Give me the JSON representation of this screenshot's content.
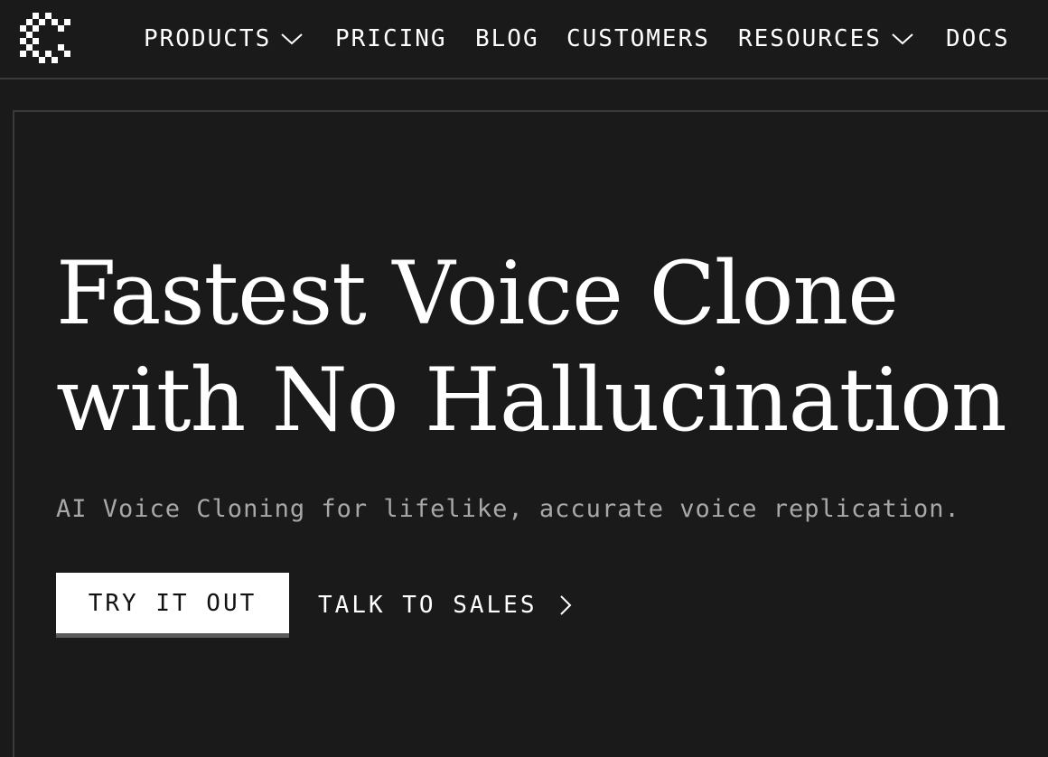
{
  "nav": {
    "products": "PRODUCTS",
    "pricing": "PRICING",
    "blog": "BLOG",
    "customers": "CUSTOMERS",
    "resources": "RESOURCES",
    "docs": "DOCS"
  },
  "icons": {
    "logo": "pixel-c-logo-icon",
    "dropdown": "chevron-down-icon",
    "arrow": "chevron-right-icon"
  },
  "hero": {
    "headline_line1": "Fastest Voice Clone",
    "headline_line2": "with No Hallucination",
    "subheadline": "AI Voice Cloning for lifelike, accurate voice replication.",
    "primary_cta": "TRY IT OUT",
    "secondary_cta": "TALK TO SALES"
  },
  "colors": {
    "background": "#1a1a1a",
    "text": "#ffffff",
    "muted_text": "#a8a8a8",
    "border": "#3a3a3a",
    "button_bg": "#ffffff",
    "button_shadow": "#5b5b5b"
  }
}
